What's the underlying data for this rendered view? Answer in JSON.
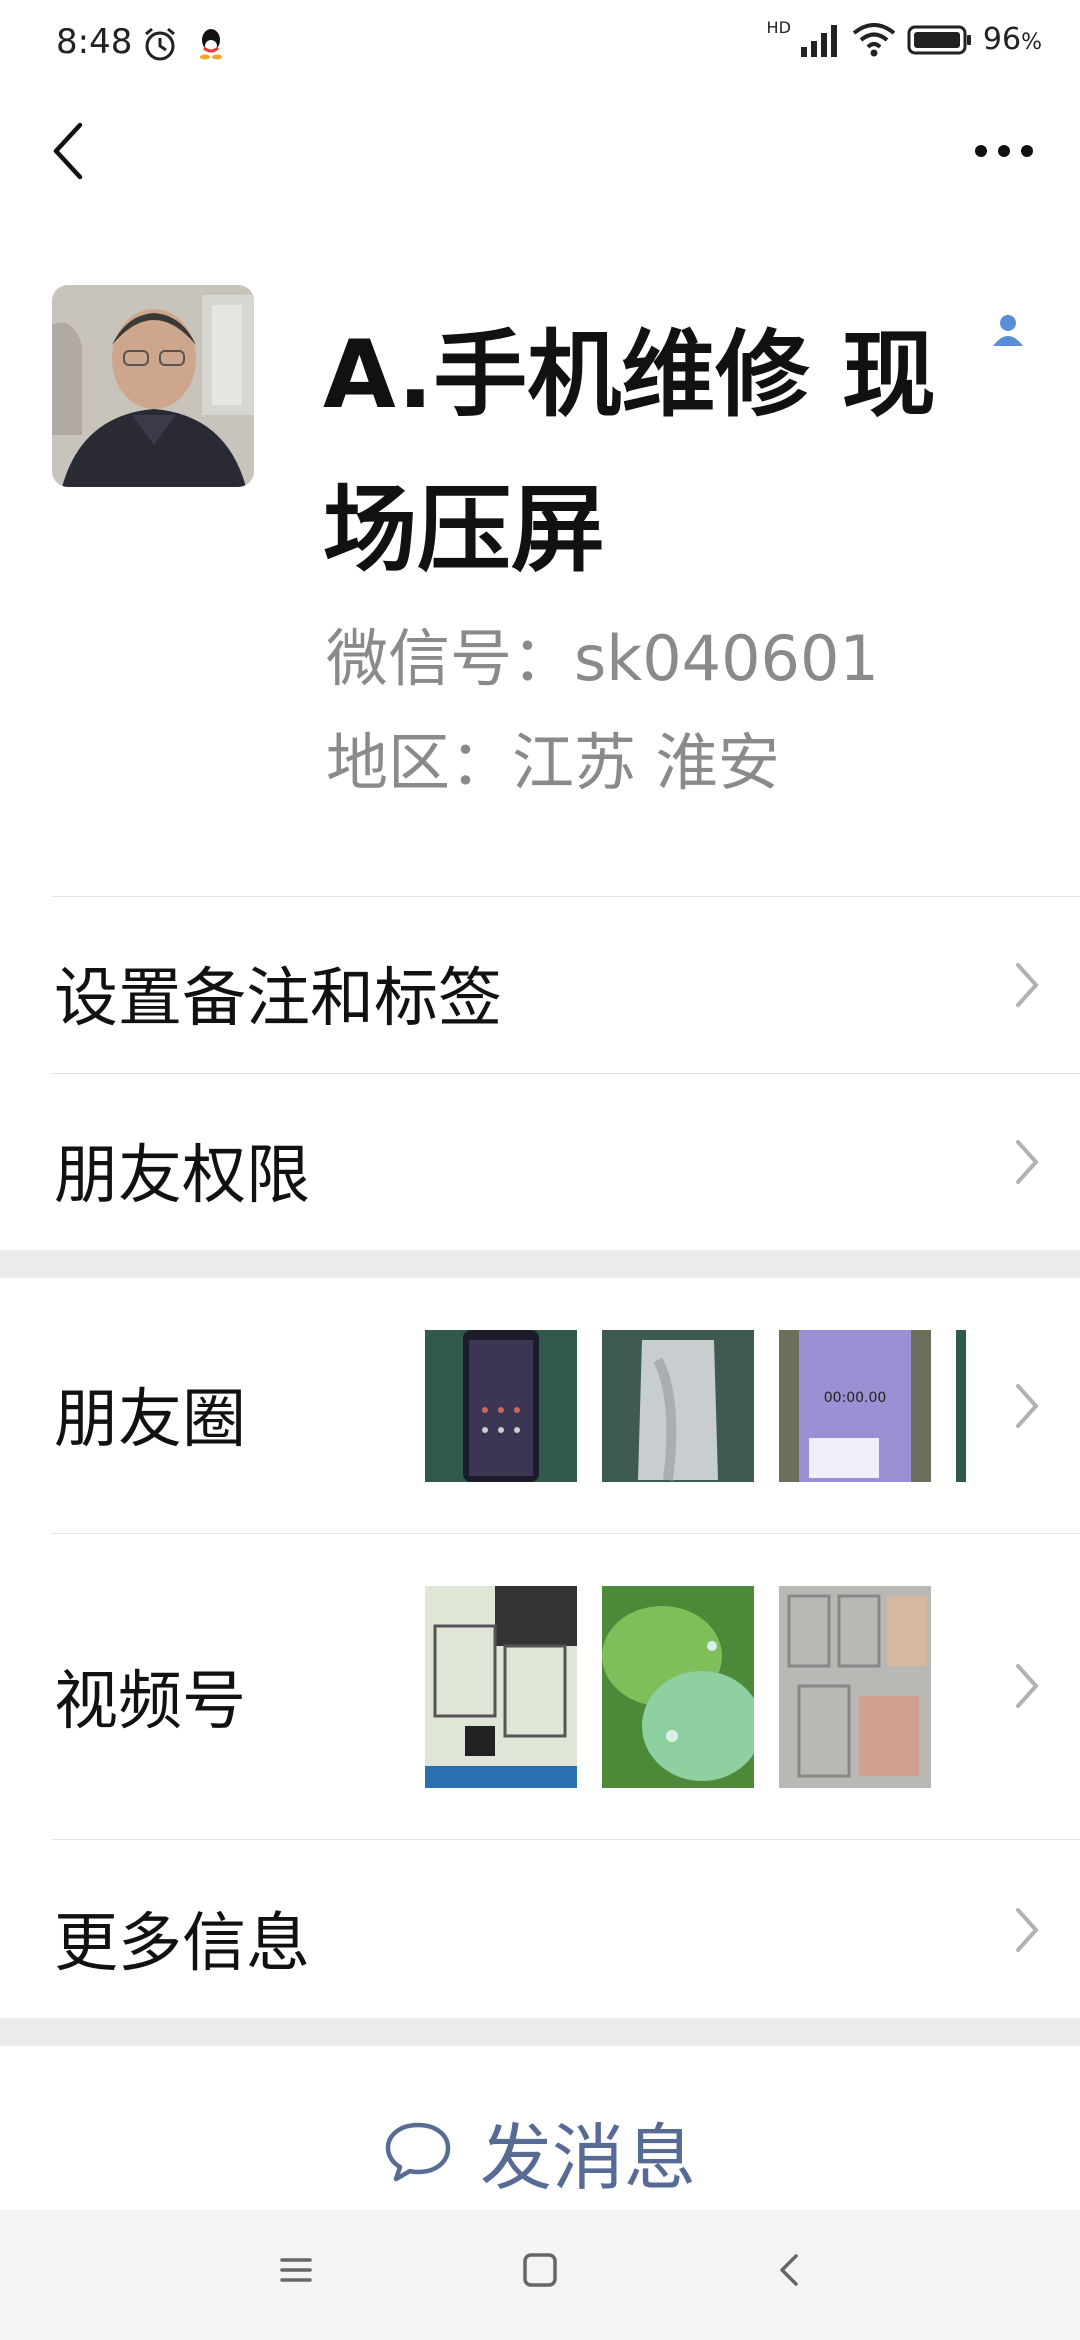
{
  "status_bar": {
    "time": "8:48",
    "battery": "96",
    "battery_unit": "%",
    "network": "HD"
  },
  "nav": {
    "back_icon": "chevron-left-icon",
    "more_icon": "more-dots-icon"
  },
  "profile": {
    "name": "A.手机维修 现场压屏",
    "wechat_id": "微信号：sk040601",
    "region": "地区：江苏  淮安"
  },
  "rows": {
    "remark": "设置备注和标签",
    "permissions": "朋友权限",
    "moments": "朋友圈",
    "channels": "视频号",
    "more_info": "更多信息"
  },
  "moments_thumb_time": "00:00.00",
  "send_message": "发消息",
  "colors": {
    "accent": "#576b95",
    "band": "#ececec",
    "secondary_text": "#8a8a8a"
  }
}
